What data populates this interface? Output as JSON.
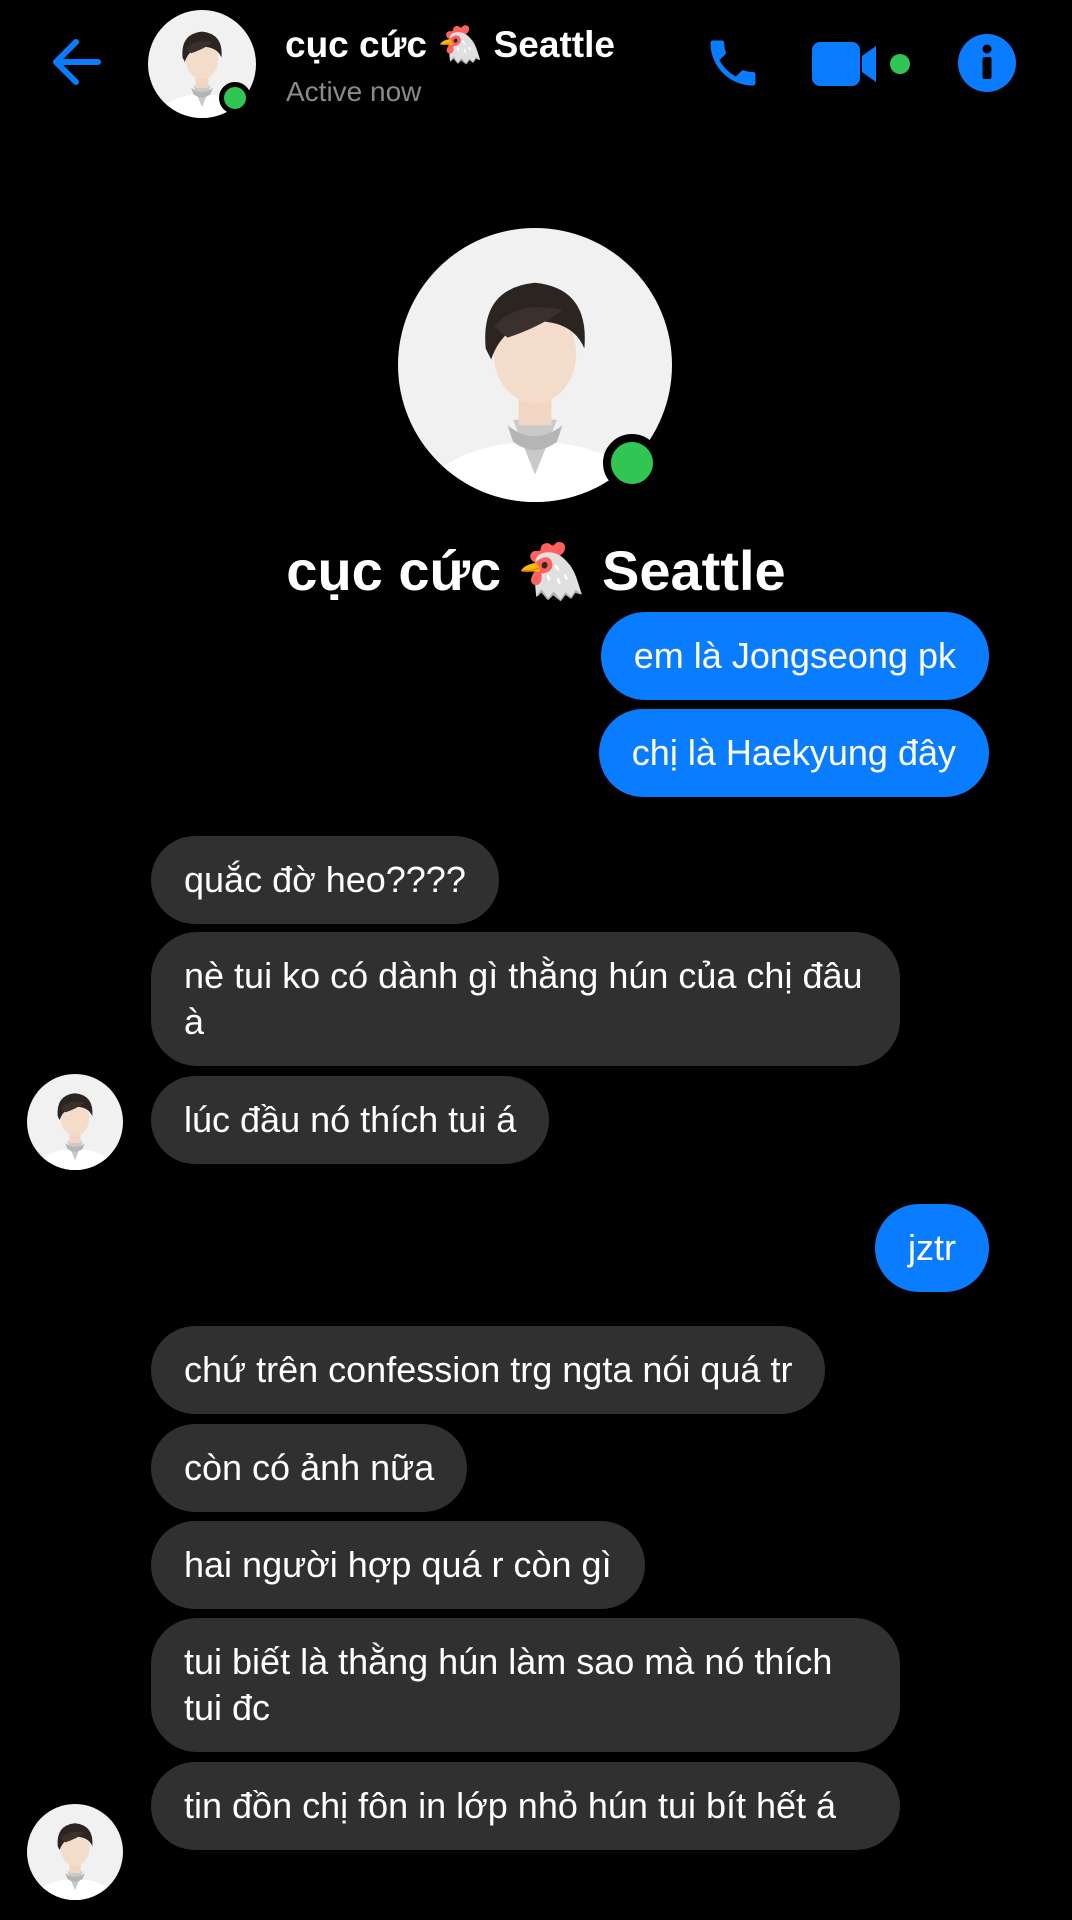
{
  "header": {
    "name": "cục cức 🐔 Seattle",
    "status": "Active now"
  },
  "icons": {
    "back": "arrow-left-icon",
    "call": "phone-icon",
    "video": "video-camera-icon",
    "info": "info-icon"
  },
  "profile": {
    "name": "cục cức 🐔 Seattle"
  },
  "colors": {
    "accent": "#0a7cff",
    "incoming_bubble": "#303030",
    "online": "#31c553",
    "muted_text": "#8a8a8a"
  },
  "messages": [
    {
      "from": "me",
      "text": "em là Jongseong pk"
    },
    {
      "from": "me",
      "text": "chị là Haekyung đây"
    },
    {
      "from": "them",
      "text": "quắc đờ heo????"
    },
    {
      "from": "them",
      "text": "nè tui ko có dành gì thằng hún của chị đâu à"
    },
    {
      "from": "them",
      "text": "lúc đầu nó thích tui á"
    },
    {
      "from": "me",
      "text": "jztr"
    },
    {
      "from": "them",
      "text": "chứ trên confession trg ngta nói quá tr"
    },
    {
      "from": "them",
      "text": "còn có ảnh nữa"
    },
    {
      "from": "them",
      "text": "hai người hợp quá r còn gì"
    },
    {
      "from": "them",
      "text": "tui biết là thằng hún làm sao mà nó thích tui đc"
    },
    {
      "from": "them",
      "text": "tin đồn chị fôn in lớp nhỏ hún tui bít hết á"
    }
  ]
}
